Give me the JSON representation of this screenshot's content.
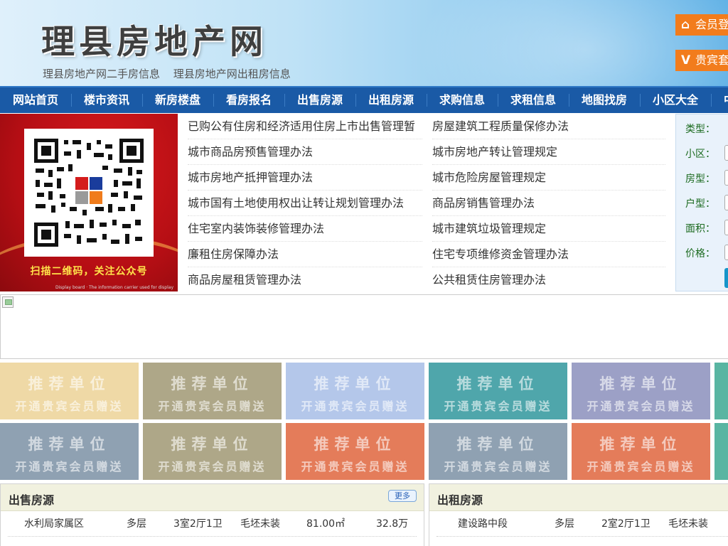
{
  "header": {
    "site_title": "理县房地产网",
    "sub_links": [
      "理县房地产网二手房信息",
      "理县房地产网出租房信息"
    ],
    "member_login": "会员登",
    "vip_label": "贵宾套"
  },
  "nav": {
    "items": [
      "网站首页",
      "楼市资讯",
      "新房楼盘",
      "看房报名",
      "出售房源",
      "出租房源",
      "求购信息",
      "求租信息",
      "地图找房",
      "小区大全",
      "中"
    ]
  },
  "banner": {
    "caption": "扫描二维码，关注公众号",
    "note": "Display board · The information carrier used for display"
  },
  "news": {
    "left": [
      "已购公有住房和经济适用住房上市出售管理暂",
      "城市商品房预售管理办法",
      "城市房地产抵押管理办法",
      "城市国有土地使用权出让转让规划管理办法",
      "住宅室内装饰装修管理办法",
      "廉租住房保障办法",
      "商品房屋租赁管理办法"
    ],
    "right": [
      "房屋建筑工程质量保修办法",
      "城市房地产转让管理规定",
      "城市危险房屋管理规定",
      "商品房销售管理办法",
      "城市建筑垃圾管理规定",
      "住宅专项维修资金管理办法",
      "公共租赁住房管理办法"
    ]
  },
  "search": {
    "labels": [
      "类型：",
      "小区：",
      "房型：",
      "户型：",
      "面积：",
      "价格："
    ]
  },
  "recommend": {
    "line1": "推荐单位",
    "line2": "开通贵宾会员赠送",
    "colors_row1": [
      "#efd9a6",
      "#aea788",
      "#b4c7ea",
      "#4fa6ab",
      "#9ca0c6",
      "#59b5a2"
    ],
    "colors_row2": [
      "#8fa1b2",
      "#aea788",
      "#e47c5a",
      "#8fa1b2",
      "#e47c5a",
      "#59b5a2"
    ]
  },
  "sale": {
    "title": "出售房源",
    "more": "更多",
    "rows": [
      {
        "name": "水利局家属区",
        "type": "多层",
        "layout": "3室2厅1卫",
        "decor": "毛坯未装",
        "area": "81.00㎡",
        "price": "32.8万"
      }
    ]
  },
  "rent": {
    "title": "出租房源",
    "rows": [
      {
        "name": "建设路中段",
        "type": "多层",
        "layout": "2室2厅1卫",
        "decor": "毛坯未装"
      }
    ]
  }
}
